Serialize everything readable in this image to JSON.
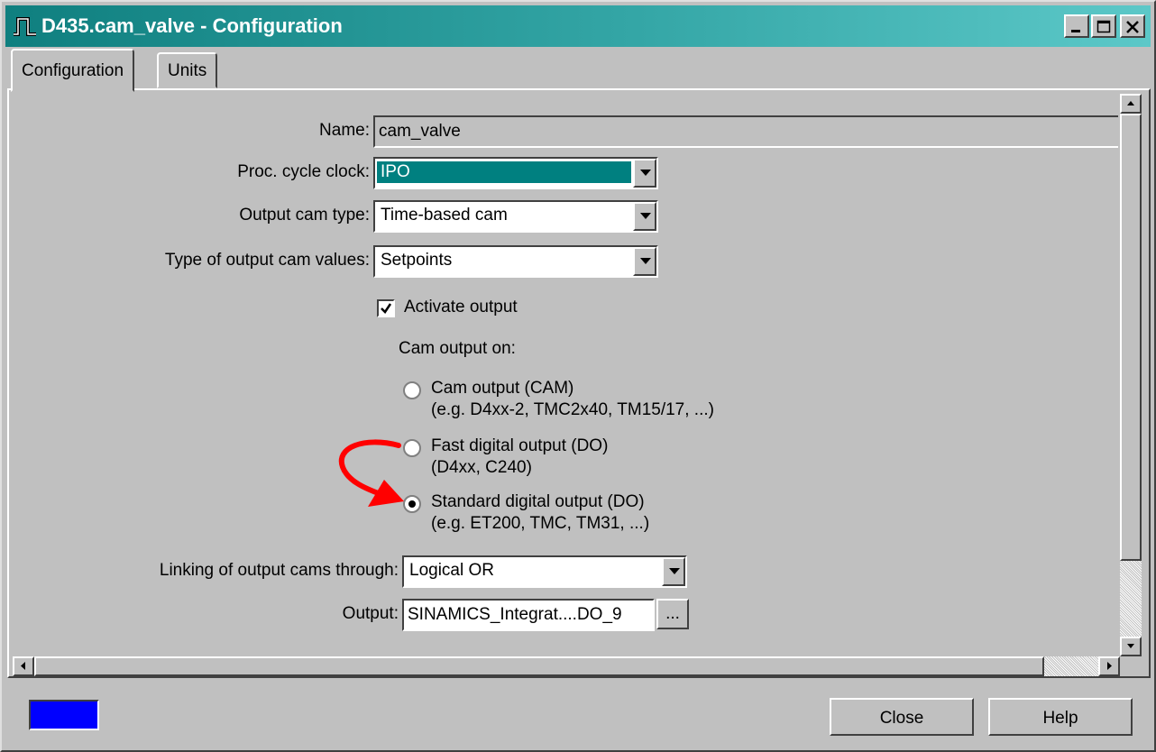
{
  "window": {
    "title": "D435.cam_valve - Configuration"
  },
  "tabs": [
    {
      "label": "Configuration",
      "active": true
    },
    {
      "label": "Units",
      "active": false
    }
  ],
  "form": {
    "name_label": "Name:",
    "name_value": "cam_valve",
    "cycle_label": "Proc. cycle clock:",
    "cycle_value": "IPO",
    "camtype_label": "Output cam type:",
    "camtype_value": "Time-based cam",
    "values_label": "Type of output cam values:",
    "values_value": "Setpoints",
    "activate_label": "Activate output",
    "activate_checked": true,
    "cam_output_on_label": "Cam output on:",
    "radios": [
      {
        "line1": "Cam output (CAM)",
        "line2": "(e.g. D4xx-2, TMC2x40,  TM15/17, ...)",
        "selected": false
      },
      {
        "line1": "Fast digital output (DO)",
        "line2": "(D4xx, C240)",
        "selected": false
      },
      {
        "line1": "Standard digital output (DO)",
        "line2": "(e.g. ET200, TMC, TM31, ...)",
        "selected": true
      }
    ],
    "linking_label": "Linking of output cams through:",
    "linking_value": "Logical OR",
    "output_label": "Output:",
    "output_value": "SINAMICS_Integrat....DO_9",
    "browse_label": "..."
  },
  "footer": {
    "close_label": "Close",
    "help_label": "Help"
  },
  "colors": {
    "status_swatch": "#0000ff",
    "selection": "#008080",
    "annotation_arrow": "#ff0000"
  }
}
